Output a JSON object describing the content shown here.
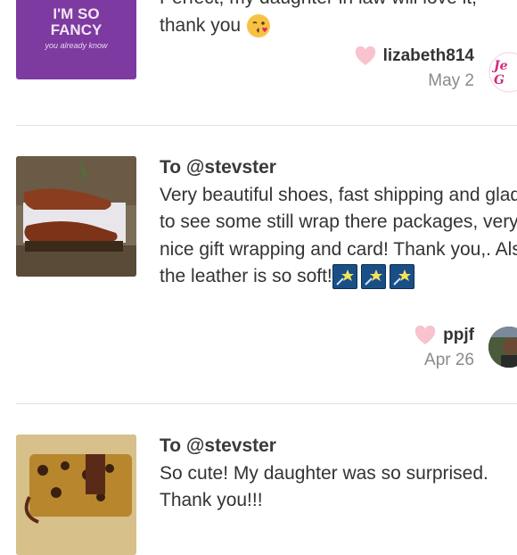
{
  "reviews": [
    {
      "text_line1": "Perfect, my daughter in law will love it,",
      "text_line2": "thank you",
      "thumb_text1": "I'M SO",
      "thumb_text2": "FANCY",
      "thumb_text3": "you already know",
      "username": "lizabeth814",
      "date": "May 2"
    },
    {
      "to": "To @stevster",
      "text": "Very beautiful shoes, fast shipping and glad to see some still wrap there packages, very nice gift wrapping and card! Thank you,. Also the leather is so soft!",
      "username": "ppjf",
      "date": "Apr 26"
    },
    {
      "to": "To @stevster",
      "text": "So cute! My daughter was so surprised. Thank you!!!"
    }
  ],
  "colors": {
    "heart": "#f9c2cc",
    "divider": "#e2e2e2",
    "date": "#8a8a8a"
  },
  "icons": [
    "heart-icon",
    "star-emoji-icon",
    "kiss-emoji-icon"
  ]
}
